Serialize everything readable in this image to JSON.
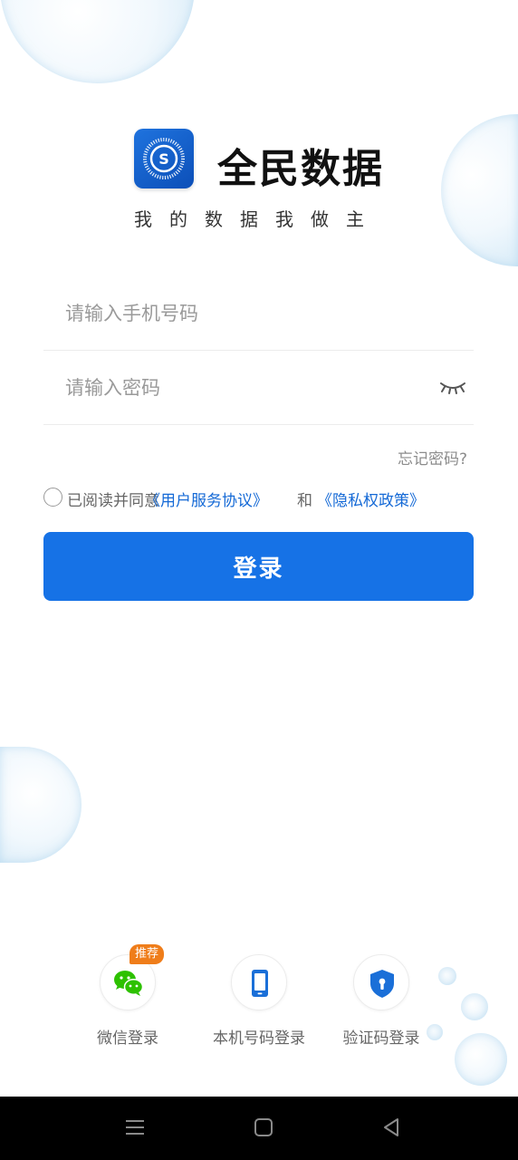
{
  "app": {
    "name": "全民数据",
    "slogan": "我的数据我做主",
    "logo_letter": "S"
  },
  "form": {
    "phone_placeholder": "请输入手机号码",
    "password_placeholder": "请输入密码",
    "forgot_label": "忘记密码?"
  },
  "agreement": {
    "prefix": "已阅读并同意",
    "user_agreement": "《用户服务协议》",
    "conjunction": "和",
    "privacy_policy": "《隐私权政策》"
  },
  "login_button": "登录",
  "alt_login": {
    "wechat": {
      "label": "微信登录",
      "badge": "推荐",
      "icon": "wechat-icon"
    },
    "local_phone": {
      "label": "本机号码登录",
      "icon": "phone-icon"
    },
    "sms_code": {
      "label": "验证码登录",
      "icon": "shield-icon"
    }
  },
  "nav_bar": {
    "items": [
      "menu-icon",
      "home-icon",
      "back-icon"
    ]
  },
  "colors": {
    "primary": "#1672e6",
    "link": "#1469d6",
    "badge": "#ef7d1a",
    "wechat": "#2dc100",
    "shield": "#1a6fd8"
  }
}
